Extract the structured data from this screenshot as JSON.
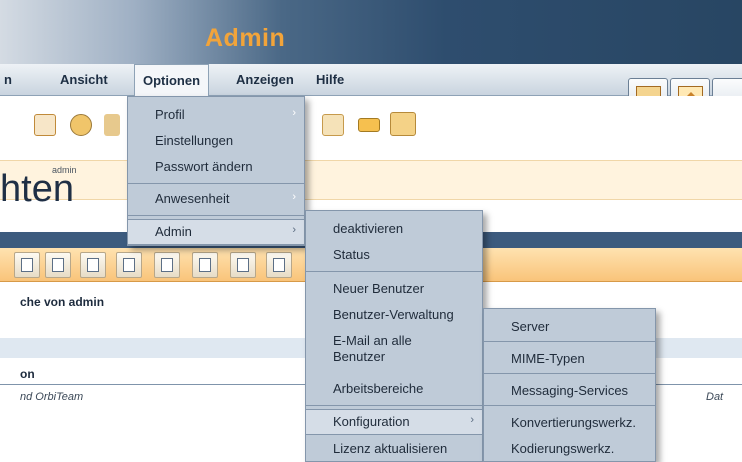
{
  "header": {
    "title": "Admin"
  },
  "menubar": {
    "items": [
      "n",
      "Ansicht",
      "Optionen",
      "Anzeigen",
      "Hilfe"
    ]
  },
  "yellow_band": {
    "small_text": "admin",
    "large_fragment": "hten"
  },
  "content": {
    "subtitle": "che von admin",
    "section_label": "on",
    "italic_left": "nd OrbiTeam",
    "italic_right": "Dat"
  },
  "options_menu": {
    "items": [
      "Profil",
      "Einstellungen",
      "Passwort ändern",
      "Anwesenheit",
      "Admin"
    ]
  },
  "admin_menu": {
    "items": [
      "deaktivieren",
      "Status",
      "Neuer Benutzer",
      "Benutzer-Verwaltung",
      "E-Mail an alle Benutzer",
      "Arbeitsbereiche",
      "Konfiguration",
      "Lizenz aktualisieren"
    ]
  },
  "config_menu": {
    "items": [
      "Server",
      "MIME-Typen",
      "Messaging-Services",
      "Konvertierungswerkz.",
      "Kodierungswerkz."
    ]
  },
  "icons": [
    "document-add-icon",
    "globe-gear-icon",
    "arrow-document-icon",
    "card-icon",
    "folder-star-icon",
    "grid-icon",
    "home-icon"
  ],
  "colors": {
    "accent": "#f2a43a",
    "header_dark": "#2e4d6e",
    "menu_bg": "#bfcbd8",
    "orange_bar": "#f9c47a"
  }
}
